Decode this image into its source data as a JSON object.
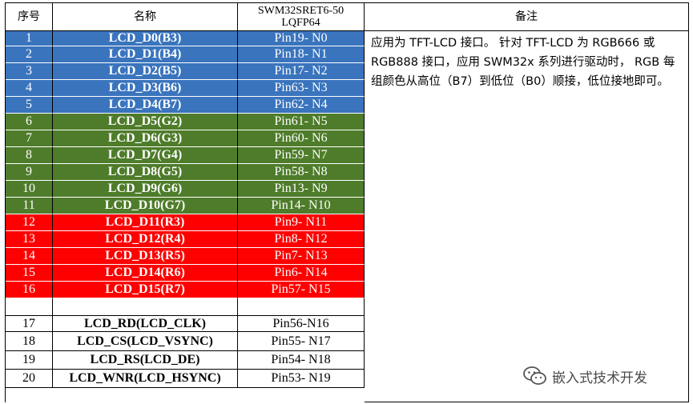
{
  "table": {
    "headers": {
      "index": "序号",
      "name": "名称",
      "pin_line1": "SWM32SRET6-50",
      "pin_line2": "LQFP64",
      "note": "备注"
    },
    "groups": [
      {
        "color": "blue",
        "rows": [
          {
            "index": "1",
            "name": "LCD_D0(B3)",
            "pin": "Pin19- N0"
          },
          {
            "index": "2",
            "name": "LCD_D1(B4)",
            "pin": "Pin18- N1"
          },
          {
            "index": "3",
            "name": "LCD_D2(B5)",
            "pin": "Pin17- N2"
          },
          {
            "index": "4",
            "name": "LCD_D3(B6)",
            "pin": "Pin63- N3"
          },
          {
            "index": "5",
            "name": "LCD_D4(B7)",
            "pin": "Pin62- N4"
          }
        ]
      },
      {
        "color": "green",
        "rows": [
          {
            "index": "6",
            "name": "LCD_D5(G2)",
            "pin": "Pin61- N5"
          },
          {
            "index": "7",
            "name": "LCD_D6(G3)",
            "pin": "Pin60- N6"
          },
          {
            "index": "8",
            "name": "LCD_D7(G4)",
            "pin": "Pin59- N7"
          },
          {
            "index": "9",
            "name": "LCD_D8(G5)",
            "pin": "Pin58- N8"
          },
          {
            "index": "10",
            "name": "LCD_D9(G6)",
            "pin": "Pin13- N9"
          },
          {
            "index": "11",
            "name": "LCD_D10(G7)",
            "pin": "Pin14- N10"
          }
        ]
      },
      {
        "color": "red",
        "rows": [
          {
            "index": "12",
            "name": "LCD_D11(R3)",
            "pin": "Pin9- N11"
          },
          {
            "index": "13",
            "name": "LCD_D12(R4)",
            "pin": "Pin8- N12"
          },
          {
            "index": "14",
            "name": "LCD_D13(R5)",
            "pin": "Pin7- N13"
          },
          {
            "index": "15",
            "name": "LCD_D14(R6)",
            "pin": "Pin6- N14"
          },
          {
            "index": "16",
            "name": "LCD_D15(R7)",
            "pin": "Pin57- N15"
          }
        ]
      },
      {
        "color": "white",
        "rows": [
          {
            "index": "",
            "name": "",
            "pin": ""
          },
          {
            "index": "17",
            "name": "LCD_RD(LCD_CLK)",
            "pin": "Pin56-N16"
          },
          {
            "index": "18",
            "name": "LCD_CS(LCD_VSYNC)",
            "pin": "Pin55- N17"
          },
          {
            "index": "19",
            "name": "LCD_RS(LCD_DE)",
            "pin": "Pin54- N18"
          },
          {
            "index": "20",
            "name": "LCD_WNR(LCD_HSYNC)",
            "pin": "Pin53- N19"
          }
        ]
      }
    ],
    "note": "应用为 TFT-LCD 接口。 针对 TFT-LCD 为 RGB666 或 RGB888 接口，应用 SWM32x 系列进行驱动时， RGB 每组颜色从高位（B7）到低位（B0）顺接，低位接地即可。"
  },
  "watermark": {
    "icon": "wechat-icon",
    "text": "嵌入式技术开发"
  },
  "colors": {
    "blue": "#3a74bd",
    "green": "#4e7c2a",
    "red": "#fe0000"
  }
}
